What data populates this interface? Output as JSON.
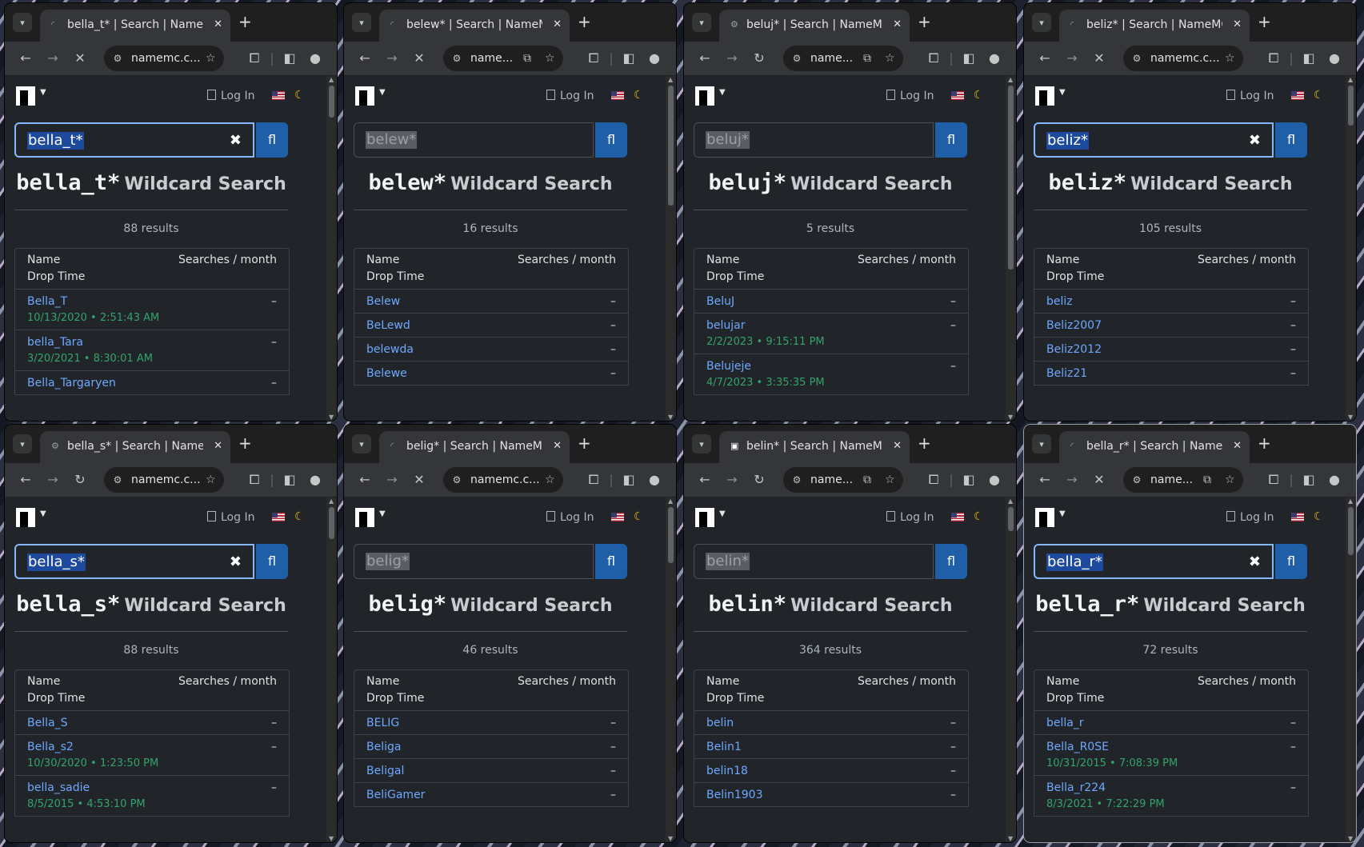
{
  "windows": [
    {
      "tab_title": "bella_t* | Search | NameMC",
      "tab_icon": "loading",
      "reload": "stop",
      "url": "namemc.c...",
      "query": "bella_t*",
      "query_state": "selected",
      "heading_query": "bella_t*",
      "heading_suffix": "Wildcard Search",
      "count": "88 results",
      "col_name": "Name",
      "col_searches": "Searches / month",
      "col_drop": "Drop Time",
      "login": "Log In",
      "active": false,
      "rows": [
        {
          "name": "Bella_T",
          "date": "10/13/2020 • 2:51:43 AM",
          "dash": "–"
        },
        {
          "name": "bella_Tara",
          "date": "3/20/2021 • 8:30:01 AM",
          "dash": "–"
        },
        {
          "name": "Bella_Targaryen",
          "date": "",
          "dash": "–"
        }
      ]
    },
    {
      "tab_title": "belew* | Search | NameMC",
      "tab_icon": "loading",
      "reload": "stop",
      "url": "name...",
      "query": "belew*",
      "query_state": "dim",
      "heading_query": "belew*",
      "heading_suffix": "Wildcard Search",
      "count": "16 results",
      "col_name": "Name",
      "col_searches": "Searches / month",
      "col_drop": "Drop Time",
      "login": "Log In",
      "active": false,
      "rows": [
        {
          "name": "Belew",
          "date": "",
          "dash": "–"
        },
        {
          "name": "BeLewd",
          "date": "",
          "dash": "–"
        },
        {
          "name": "belewda",
          "date": "",
          "dash": "–"
        },
        {
          "name": "Belewe",
          "date": "",
          "dash": "–"
        }
      ]
    },
    {
      "tab_title": "beluj* | Search | NameMC",
      "tab_icon": "gear",
      "reload": "reload",
      "url": "name...",
      "query": "beluj*",
      "query_state": "dim",
      "heading_query": "beluj*",
      "heading_suffix": "Wildcard Search",
      "count": "5 results",
      "col_name": "Name",
      "col_searches": "Searches / month",
      "col_drop": "Drop Time",
      "login": "Log In",
      "active": false,
      "rows": [
        {
          "name": "BeluJ",
          "date": "",
          "dash": "–"
        },
        {
          "name": "belujar",
          "date": "2/2/2023 • 9:15:11 PM",
          "dash": "–"
        },
        {
          "name": "Belujeje",
          "date": "4/7/2023 • 3:35:35 PM",
          "dash": "–"
        }
      ]
    },
    {
      "tab_title": "beliz* | Search | NameMC",
      "tab_icon": "loading",
      "reload": "stop",
      "url": "namemc.c...",
      "query": "beliz*",
      "query_state": "selected",
      "heading_query": "beliz*",
      "heading_suffix": "Wildcard Search",
      "count": "105 results",
      "col_name": "Name",
      "col_searches": "Searches / month",
      "col_drop": "Drop Time",
      "login": "Log In",
      "active": false,
      "rows": [
        {
          "name": "beliz",
          "date": "",
          "dash": "–"
        },
        {
          "name": "Beliz2007",
          "date": "",
          "dash": "–"
        },
        {
          "name": "Beliz2012",
          "date": "",
          "dash": "–"
        },
        {
          "name": "Beliz21",
          "date": "",
          "dash": "–"
        }
      ]
    },
    {
      "tab_title": "bella_s* | Search | NameMC",
      "tab_icon": "gear",
      "reload": "reload",
      "url": "namemc.c...",
      "query": "bella_s*",
      "query_state": "selected",
      "heading_query": "bella_s*",
      "heading_suffix": "Wildcard Search",
      "count": "88 results",
      "col_name": "Name",
      "col_searches": "Searches / month",
      "col_drop": "Drop Time",
      "login": "Log In",
      "active": false,
      "rows": [
        {
          "name": "Bella_S",
          "date": "",
          "dash": "–"
        },
        {
          "name": "Bella_s2",
          "date": "10/30/2020 • 1:23:50 PM",
          "dash": "–"
        },
        {
          "name": "bella_sadie",
          "date": "8/5/2015 • 4:53:10 PM",
          "dash": "–"
        }
      ]
    },
    {
      "tab_title": "belig* | Search | NameMC",
      "tab_icon": "loading",
      "reload": "stop",
      "url": "namemc.c...",
      "query": "belig*",
      "query_state": "dim",
      "heading_query": "belig*",
      "heading_suffix": "Wildcard Search",
      "count": "46 results",
      "col_name": "Name",
      "col_searches": "Searches / month",
      "col_drop": "Drop Time",
      "login": "Log In",
      "active": false,
      "rows": [
        {
          "name": "BELIG",
          "date": "",
          "dash": "–"
        },
        {
          "name": "Beliga",
          "date": "",
          "dash": "–"
        },
        {
          "name": "Beligal",
          "date": "",
          "dash": "–"
        },
        {
          "name": "BeliGamer",
          "date": "",
          "dash": "–"
        }
      ]
    },
    {
      "tab_title": "belin* | Search | NameMC",
      "tab_icon": "namemc",
      "reload": "reload",
      "url": "name...",
      "query": "belin*",
      "query_state": "dim",
      "heading_query": "belin*",
      "heading_suffix": "Wildcard Search",
      "count": "364 results",
      "col_name": "Name",
      "col_searches": "Searches / month",
      "col_drop": "Drop Time",
      "login": "Log In",
      "active": false,
      "rows": [
        {
          "name": "belin",
          "date": "",
          "dash": "–"
        },
        {
          "name": "Belin1",
          "date": "",
          "dash": "–"
        },
        {
          "name": "belin18",
          "date": "",
          "dash": "–"
        },
        {
          "name": "Belin1903",
          "date": "",
          "dash": "–"
        }
      ]
    },
    {
      "tab_title": "bella_r* | Search | NameMC",
      "tab_icon": "loading",
      "reload": "stop",
      "url": "name...",
      "query": "bella_r*",
      "query_state": "selected",
      "heading_query": "bella_r*",
      "heading_suffix": "Wildcard Search",
      "count": "72 results",
      "col_name": "Name",
      "col_searches": "Searches / month",
      "col_drop": "Drop Time",
      "login": "Log In",
      "active": true,
      "rows": [
        {
          "name": "bella_r",
          "date": "",
          "dash": "–"
        },
        {
          "name": "Bella_R0SE",
          "date": "10/31/2015 • 7:08:39 PM",
          "dash": "–"
        },
        {
          "name": "Bella_r224",
          "date": "8/3/2021 • 7:22:29 PM",
          "dash": "–"
        }
      ]
    }
  ],
  "icons": {
    "back": "back-arrow-icon",
    "forward": "forward-arrow-icon",
    "stop": "close-icon",
    "reload": "reload-icon",
    "star": "bookmark-star-icon",
    "extensions": "puzzle-icon",
    "sidepanel": "side-panel-icon",
    "profile": "profile-icon",
    "search": "search-icon",
    "clear": "clear-icon",
    "moon": "moon-icon"
  },
  "accent_colors": {
    "link": "#6ea8fe",
    "date": "#33a36b",
    "button": "#1e5fa8",
    "focus": "#86b7fe"
  }
}
